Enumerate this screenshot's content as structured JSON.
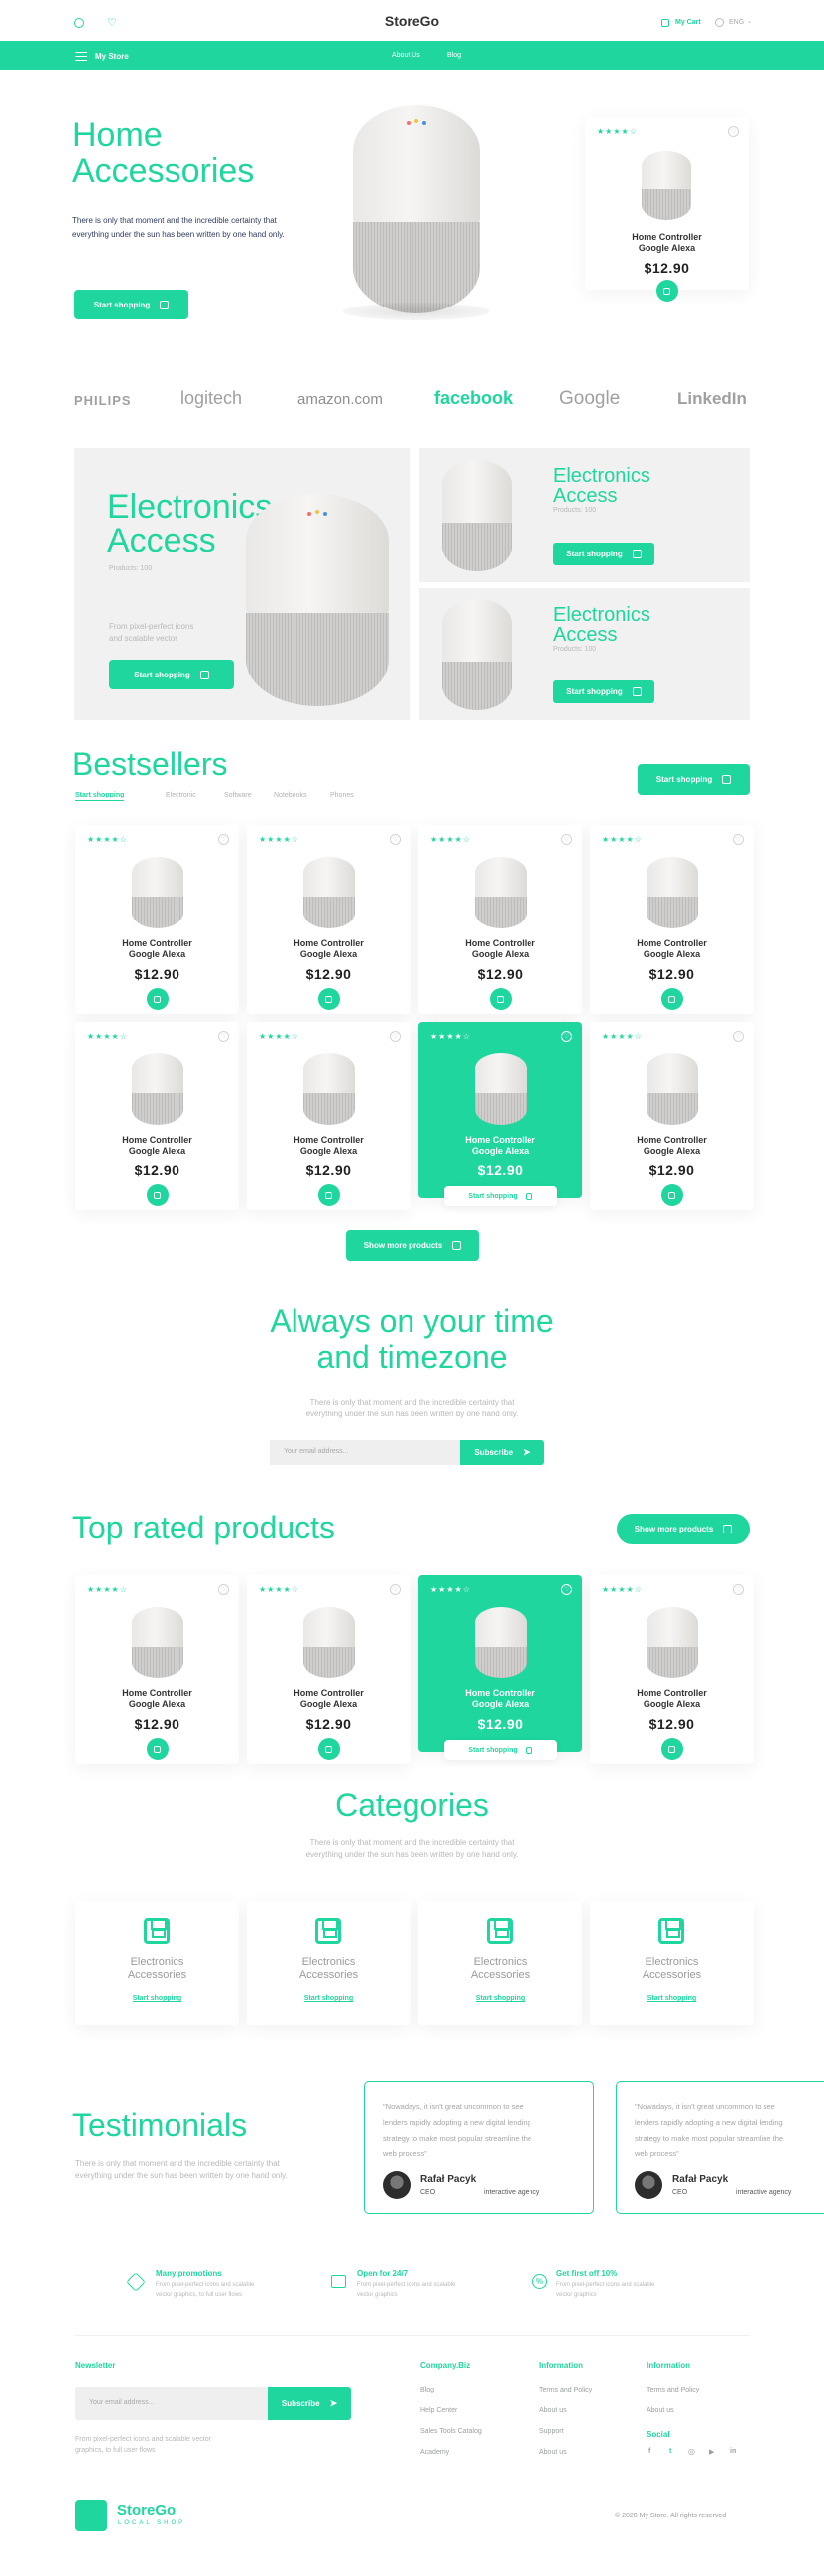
{
  "header": {
    "brand": "StoreGo",
    "cart_label": "My Cart",
    "lang_label": "ENG",
    "nav_menu_label": "My Store",
    "nav_links": [
      "About Us",
      "Blog"
    ]
  },
  "hero": {
    "title_line1": "Home",
    "title_line2": "Accessories",
    "description": "There is only that moment and the incredible certainty that everything under the sun has been written by one hand only.",
    "cta": "Start shopping",
    "card": {
      "stars": "★★★★☆",
      "name_line1": "Home Controller",
      "name_line2": "Google Alexa",
      "price": "$12.90"
    }
  },
  "brands": [
    "PHILIPS",
    "logitech",
    "amazon.com",
    "facebook",
    "Google",
    "LinkedIn"
  ],
  "promo": {
    "big": {
      "title_line1": "Electronics",
      "title_line2": "Access",
      "sub": "Products: 100",
      "desc_line1": "From pixel-perfect icons",
      "desc_line2": "and scalable vector",
      "cta": "Start shopping"
    },
    "small": [
      {
        "title_line1": "Electronics",
        "title_line2": "Access",
        "sub": "Products: 100",
        "cta": "Start shopping"
      },
      {
        "title_line1": "Electronics",
        "title_line2": "Access",
        "sub": "Products: 100",
        "cta": "Start shopping"
      }
    ]
  },
  "bestsellers": {
    "title": "Bestsellers",
    "cta": "Start shopping",
    "tabs": [
      "Start shopping",
      "Electronic",
      "Software",
      "Notebooks",
      "Phones"
    ],
    "more": "Show more products"
  },
  "product": {
    "stars": "★★★★☆",
    "fav": "♡",
    "name_line1": "Home Controller",
    "name_line2": "Google Alexa",
    "price": "$12.90",
    "hover_cta": "Start shopping"
  },
  "newsletter_hero": {
    "title_line1": "Always on your time",
    "title_line2": "and timezone",
    "desc_line1": "There is only that moment and the incredible certainty that",
    "desc_line2": "everything under the sun has been written by one hand only.",
    "placeholder": "Your email address...",
    "button": "Subscribe"
  },
  "top_rated": {
    "title": "Top rated products",
    "more": "Show more products"
  },
  "categories": {
    "title": "Categories",
    "desc_line1": "There is only that moment and the incredible certainty that",
    "desc_line2": "everything under the sun has been written by one hand only.",
    "items": [
      {
        "line1": "Electronics",
        "line2": "Accessories",
        "link": "Start shopping"
      },
      {
        "line1": "Electronics",
        "line2": "Accessories",
        "link": "Start shopping"
      },
      {
        "line1": "Electronics",
        "line2": "Accessories",
        "link": "Start shopping"
      },
      {
        "line1": "Electronics",
        "line2": "Accessories",
        "link": "Start shopping"
      }
    ]
  },
  "testimonials": {
    "title": "Testimonials",
    "desc_line1": "There is only that moment and the incredible certainty that",
    "desc_line2": "everything under the sun has been written by one hand only.",
    "items": [
      {
        "quote_line1": "\"Nowadays, it isn't great uncommon to see",
        "quote_line2": "lenders rapidly adopting a new digital lending",
        "quote_line3": "strategy to make most popular streamline the",
        "quote_line4": "web process\"",
        "name": "Rafał Pacyk",
        "role": "CEO",
        "company": "interactive agency"
      },
      {
        "quote_line1": "\"Nowadays, it isn't great uncommon to see",
        "quote_line2": "lenders rapidly adopting a new digital lending",
        "quote_line3": "strategy to make most popular streamline the",
        "quote_line4": "web process\"",
        "name": "Rafał Pacyk",
        "role": "CEO",
        "company": "interactive agency"
      }
    ]
  },
  "features": [
    {
      "title": "Many promotions",
      "desc_line1": "From pixel-perfect icons and scalable",
      "desc_line2": "vector graphics, to full user flows"
    },
    {
      "title": "Open for 24/7",
      "desc_line1": "From pixel-perfect icons and scalable",
      "desc_line2": "vector graphics"
    },
    {
      "title": "Get first off 10%",
      "desc_line1": "From pixel-perfect icons and scalable",
      "desc_line2": "vector graphics"
    }
  ],
  "footer": {
    "newsletter_title": "Newsletter",
    "newsletter_placeholder": "Your email address...",
    "newsletter_button": "Subscribe",
    "newsletter_desc_line1": "From pixel-perfect icons and scalable vector",
    "newsletter_desc_line2": "graphics, to full user flows",
    "col1_title": "Company.Biz",
    "col1_links": [
      "Blog",
      "Help Center",
      "Sales Tools Catalog",
      "Academy"
    ],
    "col2_title": "Information",
    "col2_links": [
      "Terms and Policy",
      "About us",
      "Support",
      "About us"
    ],
    "col3_title": "Information",
    "col3_links": [
      "Terms and Policy",
      "About us"
    ],
    "social_title": "Social",
    "social_icons": [
      "f",
      "t",
      "◎",
      "▶",
      "in"
    ],
    "brand": "StoreGo",
    "tagline": "LOCAL SHOP",
    "copyright": "© 2020 My Store. All rights reserved"
  },
  "colors": {
    "accent": "#1fd69f",
    "background": "#ffffff",
    "panel": "#f1f1f1"
  }
}
